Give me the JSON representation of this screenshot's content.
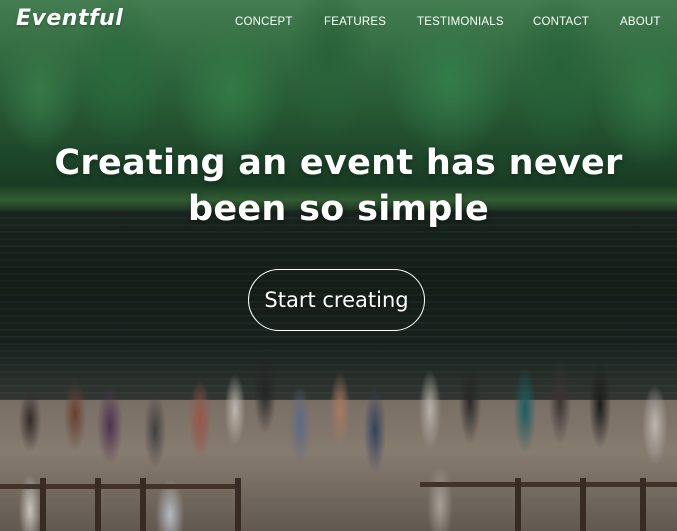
{
  "brand": {
    "logo_text": "Eventful"
  },
  "nav": {
    "items": [
      {
        "label": "CONCEPT"
      },
      {
        "label": "FEATURES"
      },
      {
        "label": "TESTIMONIALS"
      },
      {
        "label": "CONTACT"
      },
      {
        "label": "ABOUT"
      }
    ]
  },
  "hero": {
    "headline_line1": "Creating an event has never",
    "headline_line2": "been so simple",
    "cta_label": "Start creating",
    "background_image": "lakeside-dock-party-photo"
  },
  "colors": {
    "text": "#ffffff",
    "cta_border": "#ffffff"
  }
}
